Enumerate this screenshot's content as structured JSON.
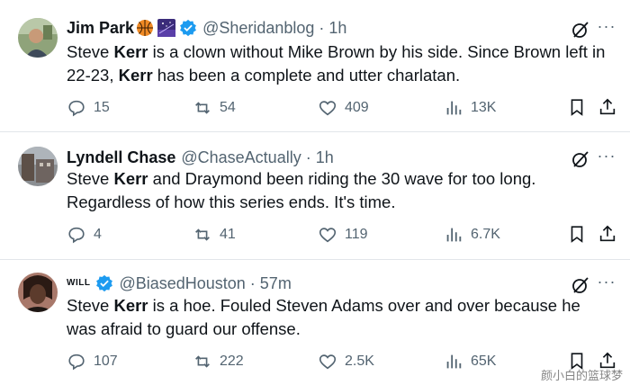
{
  "tweets": [
    {
      "name": "Jim Park",
      "name_emojis": [
        "basketball-emoji",
        "night-sky-emoji"
      ],
      "verified": true,
      "handle": "@Sheridanblog",
      "time": "1h",
      "text_parts": [
        "Steve ",
        "Kerr",
        " is a clown without Mike Brown by his side. Since Brown left in 22-23, ",
        "Kerr",
        " has been a complete and utter charlatan."
      ],
      "replies": "15",
      "reposts": "54",
      "likes": "409",
      "views": "13K"
    },
    {
      "name": "Lyndell Chase",
      "verified": false,
      "handle": "@ChaseActually",
      "time": "1h",
      "text_parts": [
        "Steve ",
        "Kerr",
        " and Draymond been riding the 30 wave for too long. Regardless of how this series ends. It's time."
      ],
      "replies": "4",
      "reposts": "41",
      "likes": "119",
      "views": "6.7K"
    },
    {
      "name": "WILL",
      "verified": true,
      "handle": "@BiasedHouston",
      "time": "57m",
      "text_parts": [
        "Steve ",
        "Kerr",
        " is a hoe. Fouled Steven Adams over and over because he was afraid to guard our offense."
      ],
      "replies": "107",
      "reposts": "222",
      "likes": "2.5K",
      "views": "65K"
    }
  ],
  "separator": "·",
  "watermark": "颜小白的篮球梦",
  "colors": {
    "verified": "#1d9bf0",
    "muted": "#536471",
    "text": "#0f1419"
  }
}
